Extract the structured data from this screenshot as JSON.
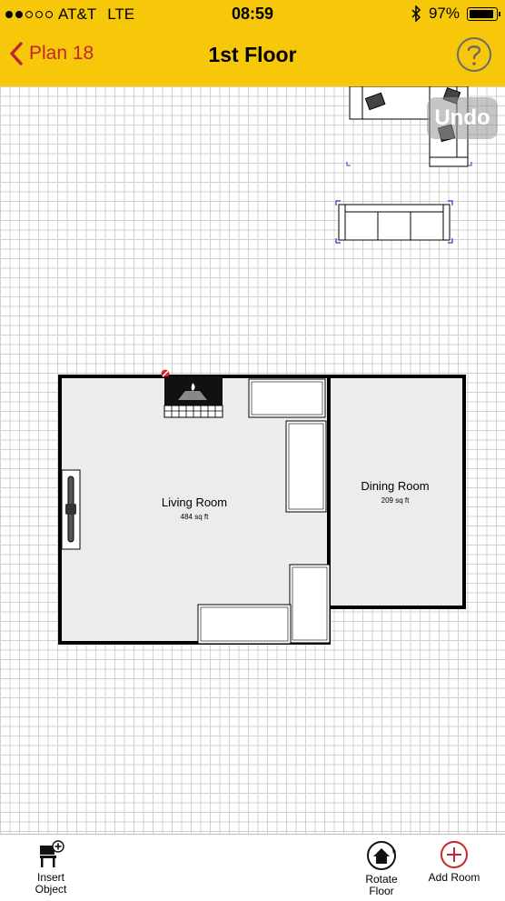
{
  "status_bar": {
    "signal_dots": [
      true,
      true,
      false,
      false,
      false
    ],
    "carrier": "AT&T",
    "network": "LTE",
    "time": "08:59",
    "battery_percent": "97%",
    "battery_level": 0.97,
    "bluetooth_icon": "bluetooth-icon"
  },
  "nav": {
    "back_label": "Plan 18",
    "title": "1st Floor",
    "help_icon": "question-circle-icon"
  },
  "canvas": {
    "undo_label": "Undo",
    "rooms": [
      {
        "name": "Living Room",
        "area": "484 sq ft"
      },
      {
        "name": "Dining Room",
        "area": "209 sq ft"
      }
    ]
  },
  "toolbar": {
    "insert_object": "Insert\nObject",
    "rotate_floor": "Rotate\nFloor",
    "add_room": "Add Room"
  },
  "colors": {
    "header": "#f7c80a",
    "accent_red": "#c5252d",
    "room_fill": "#ececec"
  }
}
